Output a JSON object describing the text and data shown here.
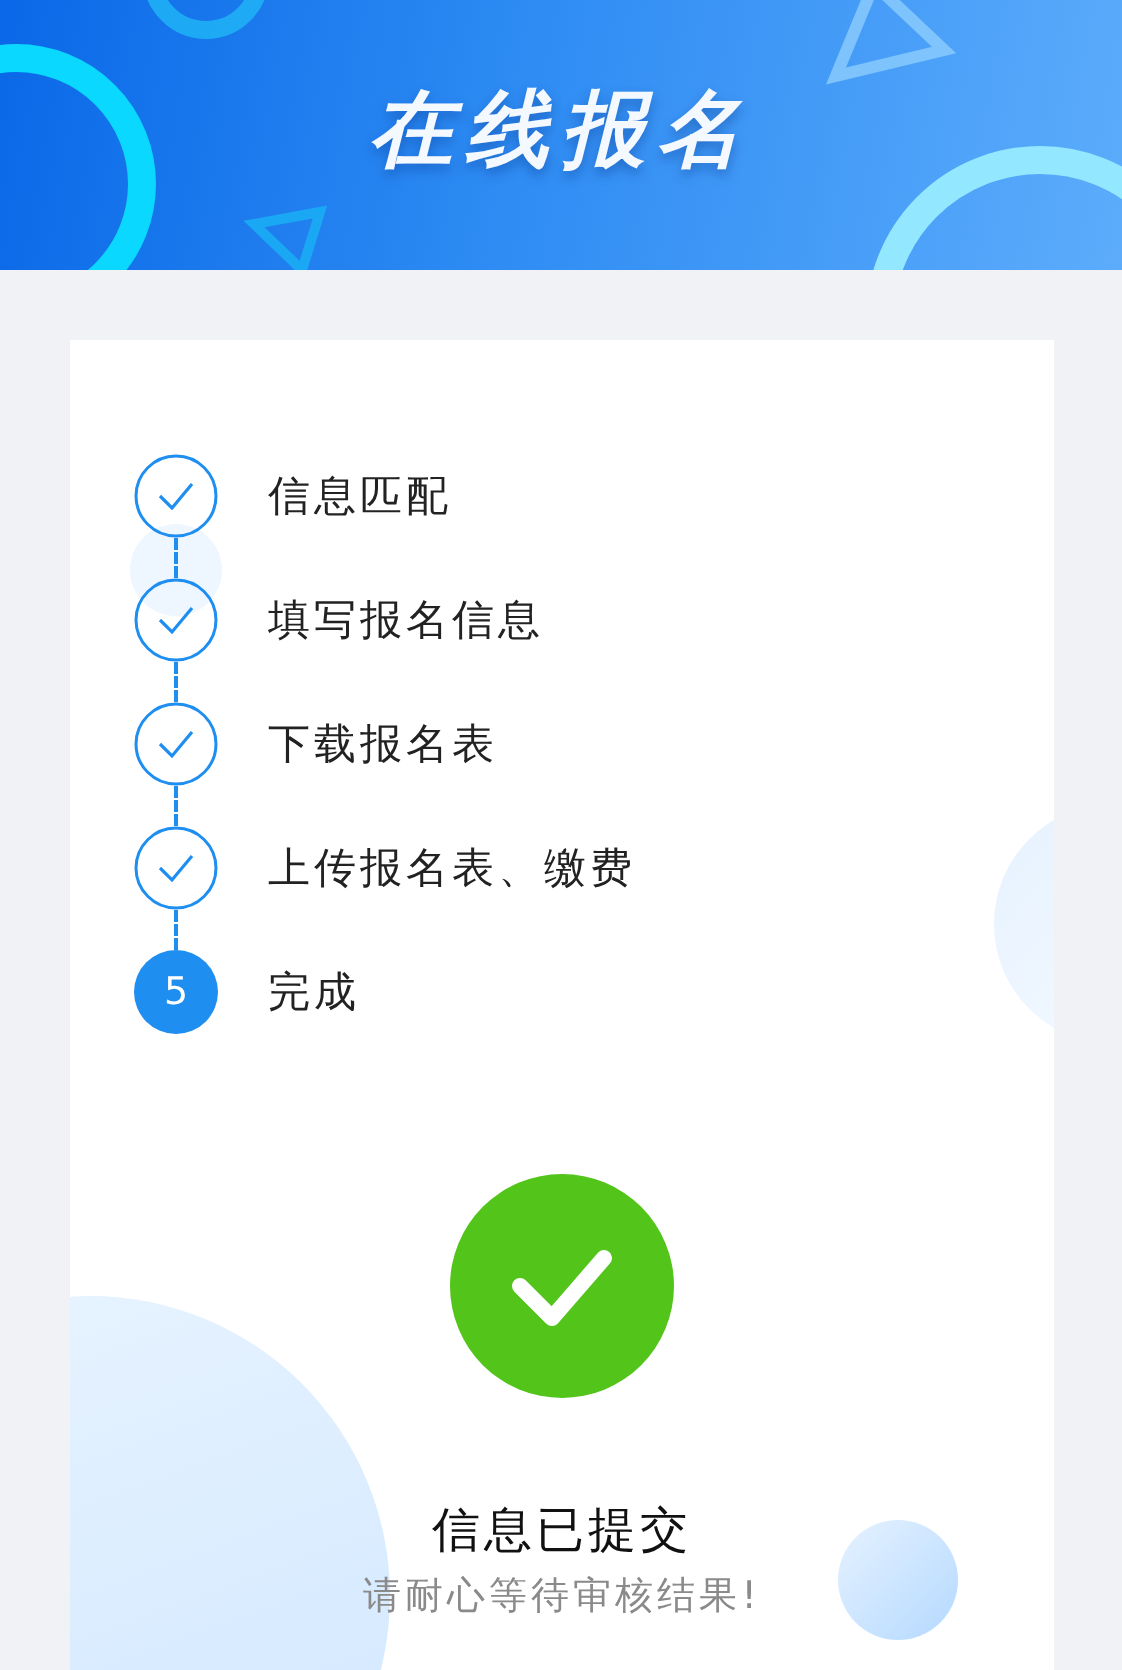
{
  "header": {
    "title": "在线报名"
  },
  "steps": [
    {
      "label": "信息匹配",
      "done": true
    },
    {
      "label": "填写报名信息",
      "done": true
    },
    {
      "label": "下载报名表",
      "done": true
    },
    {
      "label": "上传报名表、缴费",
      "done": true
    },
    {
      "label": "完成",
      "done": false,
      "number": "5"
    }
  ],
  "result": {
    "title": "信息已提交",
    "message": "请耐心等待审核结果!"
  }
}
